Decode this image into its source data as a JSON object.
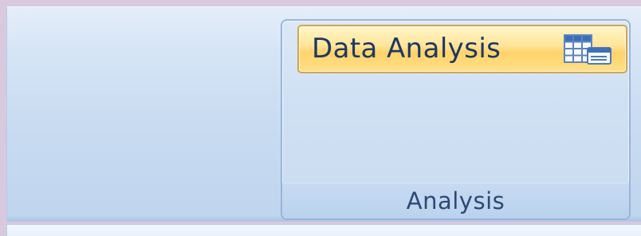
{
  "ribbon": {
    "groups": [
      {
        "label": "Analysis",
        "buttons": [
          {
            "label": "Data Analysis",
            "icon": "data-analysis-icon",
            "state": "hover"
          }
        ]
      }
    ]
  },
  "colors": {
    "ribbon_background": "#c8dbf1",
    "group_border": "#98b4da",
    "button_highlight": "#ffd36a",
    "button_border": "#d1a64d",
    "text": "#1f3762",
    "page_background": "#d9c9df"
  }
}
